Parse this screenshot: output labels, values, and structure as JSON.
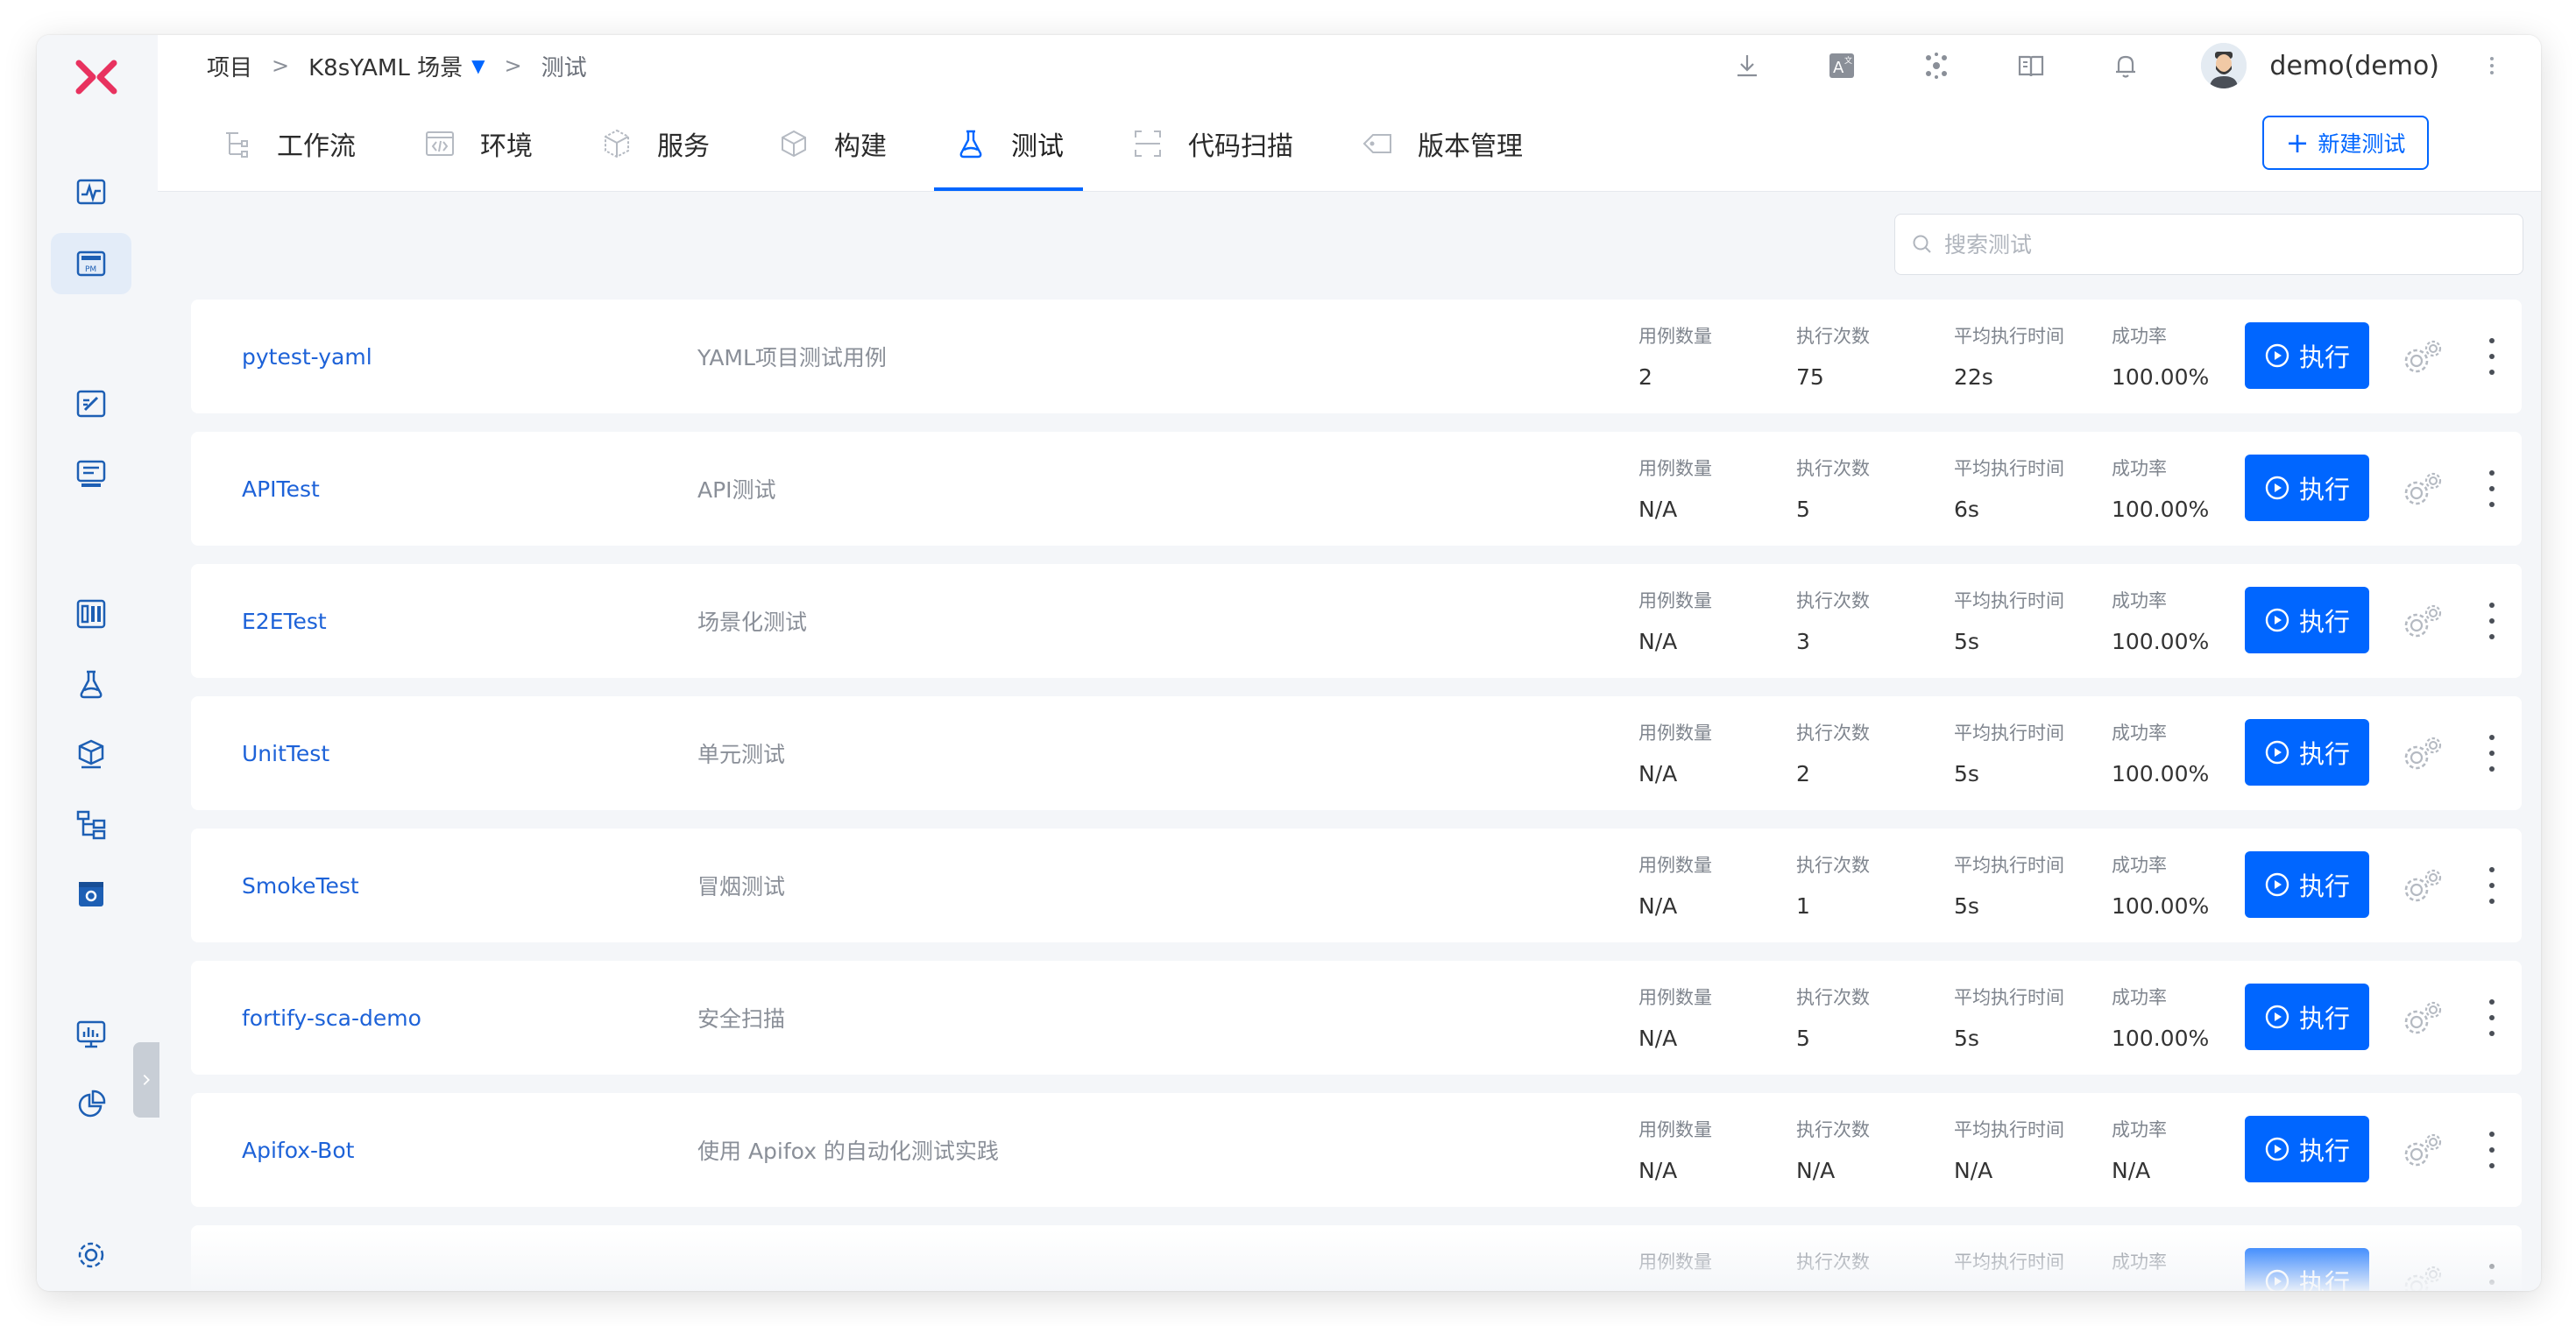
{
  "breadcrumb": {
    "root": "项目",
    "project": "K8sYAML 场景",
    "current": "测试",
    "separator": ">"
  },
  "user": {
    "name": "demo(demo)"
  },
  "tabs": [
    {
      "label": "工作流",
      "icon": "workflow-icon",
      "active": false
    },
    {
      "label": "环境",
      "icon": "environment-icon",
      "active": false
    },
    {
      "label": "服务",
      "icon": "service-icon",
      "active": false
    },
    {
      "label": "构建",
      "icon": "build-icon",
      "active": false
    },
    {
      "label": "测试",
      "icon": "flask-icon",
      "active": true
    },
    {
      "label": "代码扫描",
      "icon": "scan-icon",
      "active": false
    },
    {
      "label": "版本管理",
      "icon": "version-icon",
      "active": false
    }
  ],
  "new_button": {
    "label": "新建测试"
  },
  "search": {
    "placeholder": "搜索测试"
  },
  "columns": {
    "cases": "用例数量",
    "runs": "执行次数",
    "avg_time": "平均执行时间",
    "success_rate": "成功率"
  },
  "run_label": "执行",
  "rows": [
    {
      "name": "pytest-yaml",
      "desc": "YAML项目测试用例",
      "cases": "2",
      "runs": "75",
      "avg_time": "22s",
      "success_rate": "100.00%"
    },
    {
      "name": "APITest",
      "desc": "API测试",
      "cases": "N/A",
      "runs": "5",
      "avg_time": "6s",
      "success_rate": "100.00%"
    },
    {
      "name": "E2ETest",
      "desc": "场景化测试",
      "cases": "N/A",
      "runs": "3",
      "avg_time": "5s",
      "success_rate": "100.00%"
    },
    {
      "name": "UnitTest",
      "desc": "单元测试",
      "cases": "N/A",
      "runs": "2",
      "avg_time": "5s",
      "success_rate": "100.00%"
    },
    {
      "name": "SmokeTest",
      "desc": "冒烟测试",
      "cases": "N/A",
      "runs": "1",
      "avg_time": "5s",
      "success_rate": "100.00%"
    },
    {
      "name": "fortify-sca-demo",
      "desc": "安全扫描",
      "cases": "N/A",
      "runs": "5",
      "avg_time": "5s",
      "success_rate": "100.00%"
    },
    {
      "name": "Apifox-Bot",
      "desc": "使用 Apifox 的自动化测试实践",
      "cases": "N/A",
      "runs": "N/A",
      "avg_time": "N/A",
      "success_rate": "N/A"
    },
    {
      "name": "",
      "desc": "",
      "cases": "",
      "runs": "",
      "avg_time": "",
      "success_rate": ""
    }
  ],
  "colors": {
    "accent": "#0066ff",
    "link": "#1d62d8",
    "logo": "#e8325f",
    "sidebar_icon": "#1d5fb4"
  }
}
